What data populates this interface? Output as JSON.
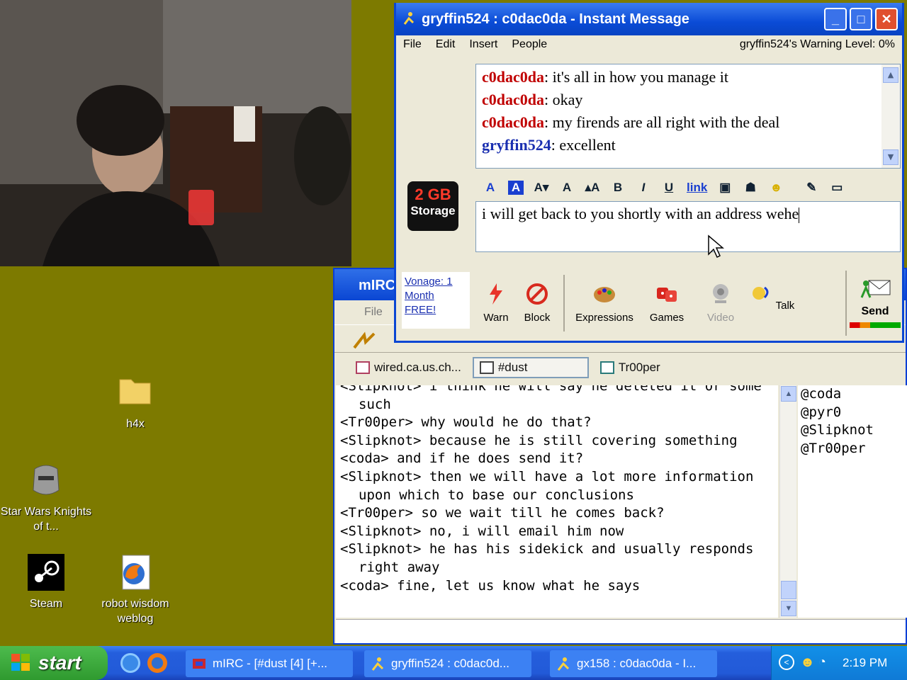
{
  "desktop": {
    "icons": [
      {
        "label": "h4x"
      },
      {
        "label": "Star Wars Knights of t..."
      },
      {
        "label": "Steam"
      },
      {
        "label": "robot wisdom weblog"
      }
    ]
  },
  "mirc": {
    "title": "mIRC",
    "menu_file": "File",
    "switchbar": [
      {
        "label": "wired.ca.us.ch..."
      },
      {
        "label": "#dust"
      },
      {
        "label": "Tr00per"
      }
    ],
    "chat_lines": [
      "<Slipknot> i think he will say he deleted it or some such",
      "<Tr00per> why would he do that?",
      "<Slipknot> because he is still covering something",
      "<coda> and if he does send it?",
      "<Slipknot> then we will have a lot more information upon which to base our conclusions",
      "<Tr00per> so we wait till he comes back?",
      "<Slipknot> no, i will email him now",
      "<Slipknot> he has his sidekick and usually responds right away",
      "<coda> fine, let us know what he says"
    ],
    "nicks": [
      "@coda",
      "@pyr0",
      "@Slipknot",
      "@Tr00per"
    ]
  },
  "aim": {
    "title": "gryffin524 : c0dac0da - Instant Message",
    "menu": [
      "File",
      "Edit",
      "Insert",
      "People"
    ],
    "warning_level": "gryffin524's Warning Level: 0%",
    "ad": {
      "size": "2 GB",
      "label": "Storage"
    },
    "history": [
      {
        "sender": "c0dac0da",
        "text": ": it's all in how you manage it",
        "self": false
      },
      {
        "sender": "c0dac0da",
        "text": ": okay",
        "self": false
      },
      {
        "sender": "c0dac0da",
        "text": ": my firends are all right with the deal",
        "self": false
      },
      {
        "sender": "gryffin524",
        "text": ": excellent",
        "self": true
      }
    ],
    "compose_text": "i will get back to you shortly with an address wehe",
    "promo": "Vonage: 1 Month FREE!",
    "format_buttons": [
      "A",
      "A",
      "A▾",
      "A",
      "▴A",
      "B",
      "I",
      "U",
      "link"
    ],
    "actions": {
      "warn": "Warn",
      "block": "Block",
      "expressions": "Expressions",
      "games": "Games",
      "video": "Video",
      "talk": "Talk",
      "send": "Send"
    }
  },
  "taskbar": {
    "start": "start",
    "tasks": [
      {
        "label": "mIRC - [#dust [4] [+..."
      },
      {
        "label": "gryffin524 : c0dac0d..."
      },
      {
        "label": "gx158 : c0dac0da - I..."
      }
    ],
    "clock": "2:19 PM"
  }
}
